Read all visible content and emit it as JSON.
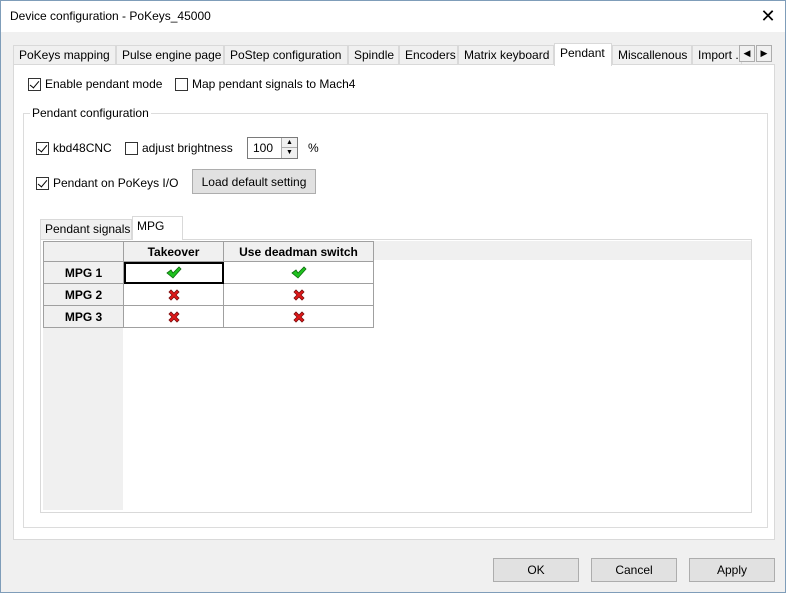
{
  "window": {
    "title": "Device configuration - PoKeys_45000"
  },
  "tabs": [
    {
      "label": "PoKeys mapping"
    },
    {
      "label": "Pulse engine page"
    },
    {
      "label": "PoStep configuration"
    },
    {
      "label": "Spindle"
    },
    {
      "label": "Encoders"
    },
    {
      "label": "Matrix keyboard"
    },
    {
      "label": "Pendant",
      "active": true
    },
    {
      "label": "Miscallenous"
    },
    {
      "label": "Import ..."
    }
  ],
  "options": {
    "enable_pendant": {
      "label": "Enable pendant mode",
      "checked": true
    },
    "map_mach4": {
      "label": "Map pendant signals to Mach4",
      "checked": false
    }
  },
  "group": {
    "title": "Pendant configuration",
    "kbd48": {
      "label": "kbd48CNC",
      "checked": true
    },
    "adjust_brightness": {
      "label": "adjust brightness",
      "checked": false
    },
    "brightness_value": "100",
    "percent": "%",
    "pendant_io": {
      "label": "Pendant on PoKeys I/O",
      "checked": true
    },
    "load_default": "Load default setting"
  },
  "subtabs": [
    {
      "label": "Pendant signals"
    },
    {
      "label": "MPG",
      "active": true
    }
  ],
  "grid": {
    "columns": [
      "Takeover",
      "Use deadman switch"
    ],
    "rows": [
      {
        "label": "MPG 1",
        "values": [
          true,
          true
        ]
      },
      {
        "label": "MPG 2",
        "values": [
          false,
          false
        ]
      },
      {
        "label": "MPG 3",
        "values": [
          false,
          false
        ]
      }
    ]
  },
  "footer": {
    "ok": "OK",
    "cancel": "Cancel",
    "apply": "Apply"
  },
  "colors": {
    "check_green": "#1fc21f",
    "cross_red": "#e0191a"
  }
}
